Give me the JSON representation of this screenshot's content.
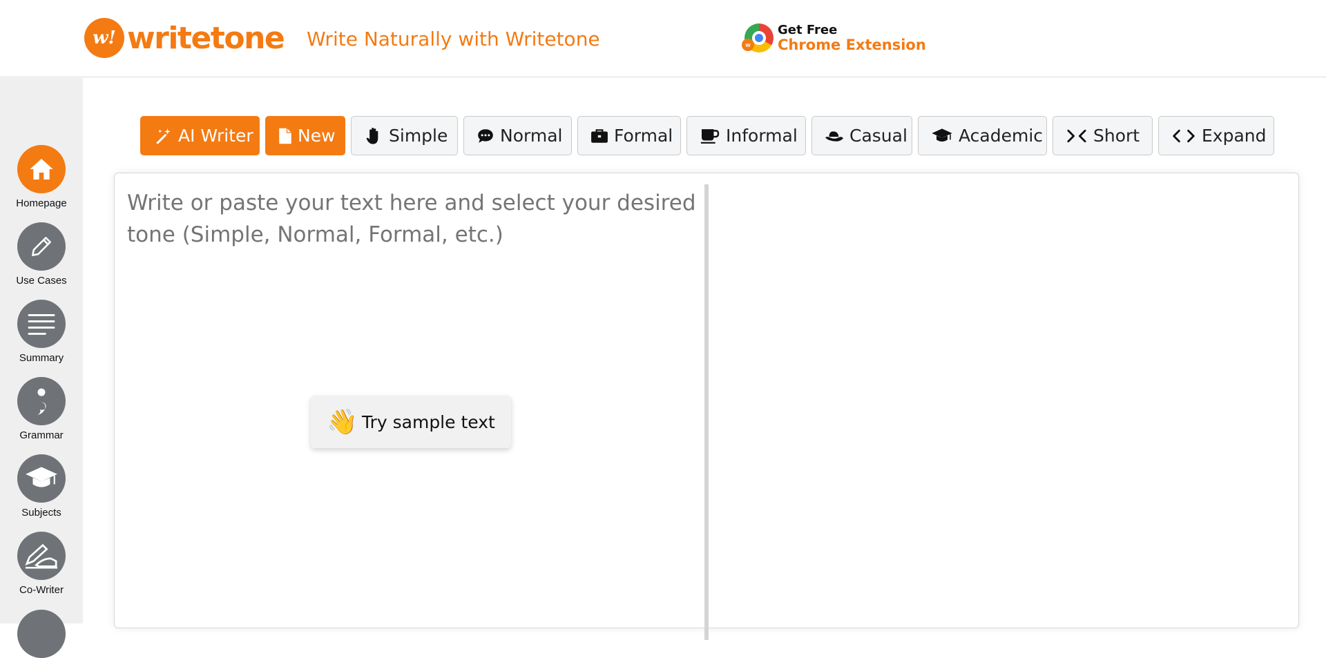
{
  "header": {
    "logo_mark": "w!",
    "logo_text": "writetone",
    "tagline": "Write Naturally with Writetone",
    "extension_line1": "Get Free",
    "extension_line2": "Chrome Extension"
  },
  "sidebar": {
    "items": [
      {
        "label": "Homepage",
        "icon": "home-icon",
        "active": true
      },
      {
        "label": "Use Cases",
        "icon": "pencil-icon",
        "active": false
      },
      {
        "label": "Summary",
        "icon": "lines-icon",
        "active": false
      },
      {
        "label": "Grammar",
        "icon": "semicolon-icon",
        "active": false
      },
      {
        "label": "Subjects",
        "icon": "graduation-cap-icon",
        "active": false
      },
      {
        "label": "Co-Writer",
        "icon": "handshake-pen-icon",
        "active": false
      }
    ]
  },
  "tabs": [
    {
      "label": "AI Writer",
      "icon": "magic-wand-icon",
      "style": "orange"
    },
    {
      "label": "New",
      "icon": "file-icon",
      "style": "orange"
    },
    {
      "label": "Simple",
      "icon": "hand-icon",
      "style": "plain"
    },
    {
      "label": "Normal",
      "icon": "speech-bubble-icon",
      "style": "plain"
    },
    {
      "label": "Formal",
      "icon": "briefcase-icon",
      "style": "plain"
    },
    {
      "label": "Informal",
      "icon": "mug-icon",
      "style": "plain"
    },
    {
      "label": "Casual",
      "icon": "hat-icon",
      "style": "plain"
    },
    {
      "label": "Academic",
      "icon": "graduation-cap-icon",
      "style": "plain"
    },
    {
      "label": "Short",
      "icon": "compress-icon",
      "style": "plain"
    },
    {
      "label": "Expand",
      "icon": "code-icon",
      "style": "plain"
    }
  ],
  "editor": {
    "placeholder": "Write or paste your text here and select your desired tone (Simple, Normal, Formal, etc.)",
    "sample_button": "Try sample text",
    "sample_icon": "waving-hand-icon"
  },
  "colors": {
    "accent": "#f47a12",
    "sidebar_bg": "#efefef",
    "sidebar_icon_bg": "#6f7377"
  }
}
